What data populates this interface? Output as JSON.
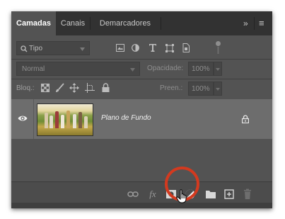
{
  "tabs": [
    {
      "label": "Camadas",
      "active": true
    },
    {
      "label": "Canais",
      "active": false
    },
    {
      "label": "Demarcadores",
      "active": false
    }
  ],
  "panel_menu": {
    "collapse_glyph": "»",
    "menu_glyph": "≡"
  },
  "filter": {
    "kind_label": "Tipo",
    "icons": [
      "image-filter-icon",
      "adjustment-filter-icon",
      "type-filter-icon",
      "shape-filter-icon",
      "smart-object-filter-icon"
    ]
  },
  "blend": {
    "mode_value": "Normal",
    "opacity_label": "Opacidade:",
    "opacity_value": "100%"
  },
  "lock": {
    "label": "Bloq.:",
    "fill_label": "Preen.:",
    "fill_value": "100%"
  },
  "layers": [
    {
      "name": "Plano de Fundo",
      "visible": true,
      "locked": true
    }
  ],
  "bottom_toolbar": [
    "link-layers-icon",
    "fx-icon",
    "add-mask-icon",
    "new-adjustment-layer-icon",
    "new-group-icon",
    "new-layer-icon",
    "delete-layer-icon"
  ],
  "colors": {
    "panel_bg": "#535353",
    "tab_bar_bg": "#323232",
    "selected_layer_bg": "#6d6d6d",
    "highlight_ring": "#d33a1f"
  }
}
